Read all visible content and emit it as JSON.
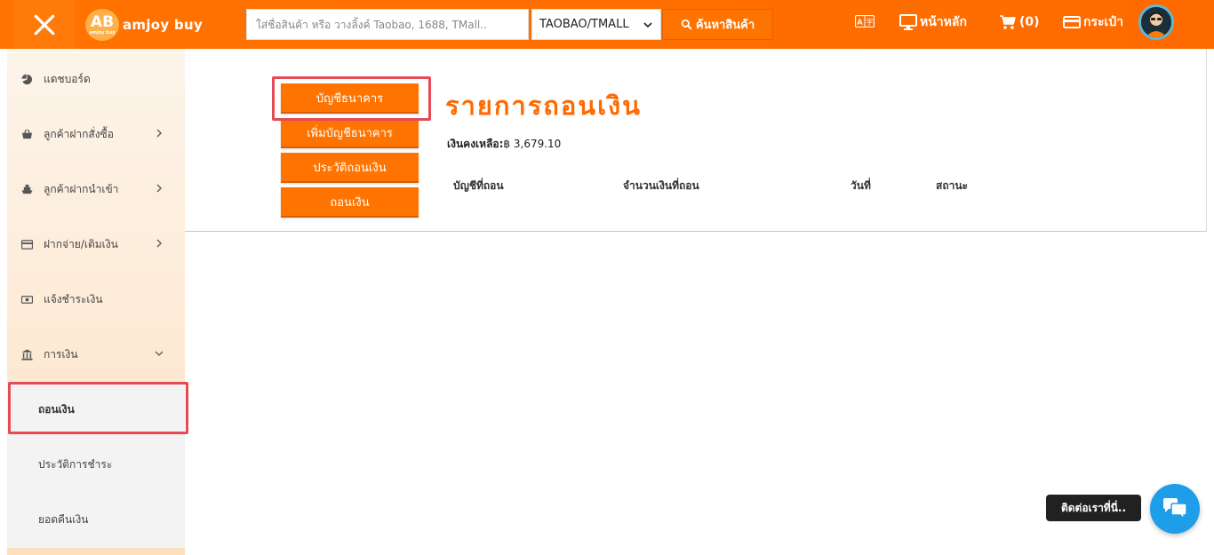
{
  "header": {
    "logo_text": "amjoy buy",
    "logo_badge": "AB",
    "logo_badge_small": "amjoy buy",
    "search_placeholder": "ใส่ชื่อสินค้า หรือ วางลิ้งค์ Taobao, 1688, TMall..",
    "search_source": "TAOBAO/TMALL",
    "search_button": "ค้นหาสินค้า",
    "nav_home": "หน้าหลัก",
    "nav_cart": "(0)",
    "nav_wallet": "กระเป๋า"
  },
  "sidebar": {
    "items": [
      {
        "label": "แดชบอร์ด"
      },
      {
        "label": "ลูกค้าฝากสั่งซื้อ"
      },
      {
        "label": "ลูกค้าฝากนำเข้า"
      },
      {
        "label": "ฝากจ่าย/เติมเงิน"
      },
      {
        "label": "แจ้งชำระเงิน"
      },
      {
        "label": "การเงิน"
      }
    ],
    "sub_items": [
      {
        "label": "ถอนเงิน"
      },
      {
        "label": "ประวัติการชำระ"
      },
      {
        "label": "ยอดคืนเงิน"
      }
    ]
  },
  "content": {
    "buttons": [
      {
        "label": "บัญชีธนาคาร"
      },
      {
        "label": "เพิ่มบัญชีธนาคาร"
      },
      {
        "label": "ประวัติถอนเงิน"
      },
      {
        "label": "ถอนเงิน"
      }
    ],
    "title": "รายการถอนเงิน",
    "balance_label": "เงินคงเหลือ:",
    "balance_value": "฿ 3,679.10",
    "table_headers": [
      "บัญชีที่ถอน",
      "จำนวนเงินที่ถอน",
      "วันที่",
      "สถานะ"
    ]
  },
  "chat": {
    "label": "ติดต่อเราที่นี่.."
  },
  "colors": {
    "accent": "#ff7400",
    "highlight": "#e64a55",
    "chat": "#1e9ee8"
  }
}
